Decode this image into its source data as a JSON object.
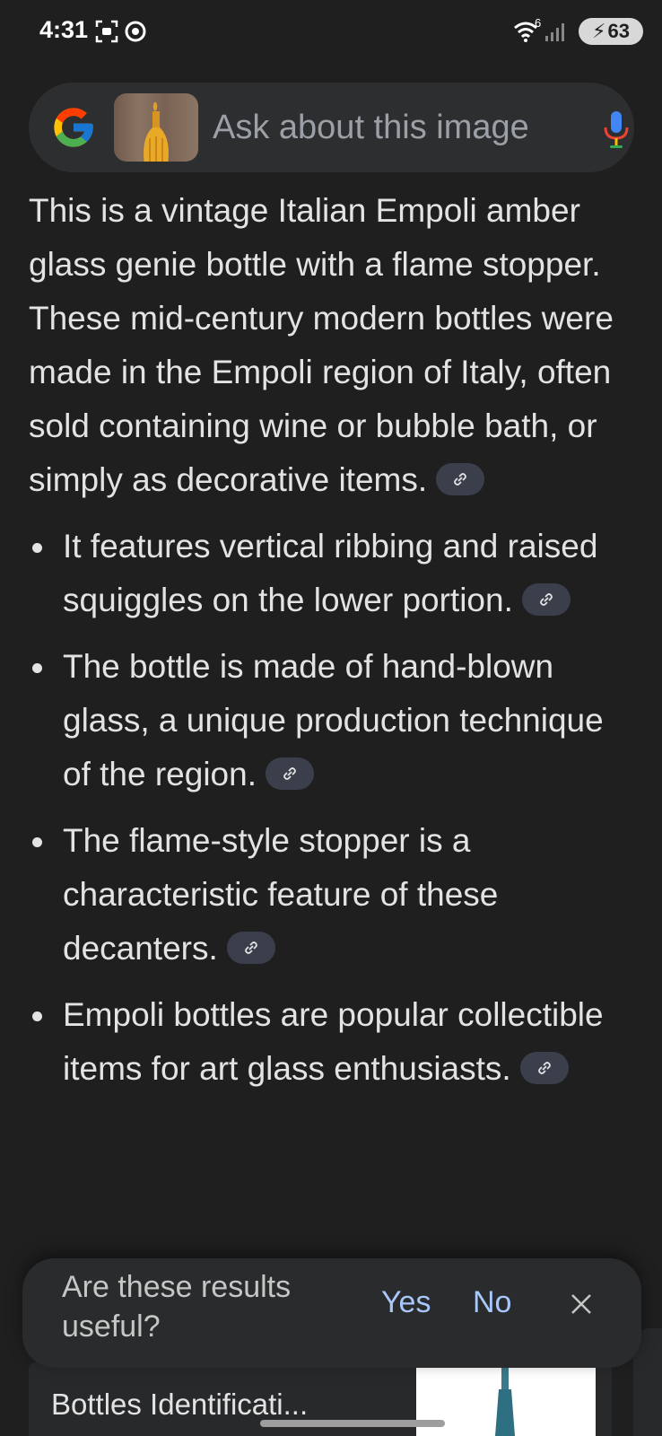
{
  "status_bar": {
    "time": "4:31",
    "battery": "63",
    "wifi_badge": "6"
  },
  "search": {
    "placeholder": "Ask about this image",
    "logo": "google-g-icon",
    "mic_icon": "mic-icon"
  },
  "answer": {
    "intro": "This is a vintage Italian Empoli amber glass genie bottle with a flame stopper. These mid-century modern bottles were made in the Empoli region of Italy, often sold containing wine or bubble bath, or simply as decorative items.",
    "bullets": [
      "It features vertical ribbing and raised squiggles on the lower portion.",
      "The bottle is made of hand-blown glass, a unique production technique of the region.",
      "The flame-style stopper is a characteristic feature of these decanters.",
      "Empoli bottles are popular collectible items for art glass enthusiasts."
    ]
  },
  "feedback": {
    "question": "Are these results useful?",
    "yes": "Yes",
    "no": "No"
  },
  "result_card": {
    "title": "Bottles Identificati..."
  },
  "colors": {
    "background": "#1f1f1f",
    "link_accent": "#a8c7fa"
  }
}
